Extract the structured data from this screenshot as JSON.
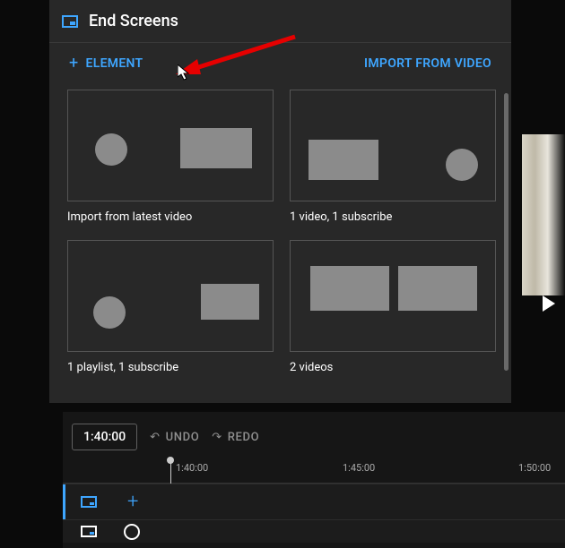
{
  "header": {
    "title": "End Screens"
  },
  "actions": {
    "element_label": "ELEMENT",
    "import_label": "IMPORT FROM VIDEO"
  },
  "templates": [
    {
      "label": "Import from latest video"
    },
    {
      "label": "1 video, 1 subscribe"
    },
    {
      "label": "1 playlist, 1 subscribe"
    },
    {
      "label": "2 videos"
    }
  ],
  "timeline": {
    "current_time": "1:40:00",
    "undo_label": "UNDO",
    "redo_label": "REDO",
    "ticks": [
      "1:40:00",
      "1:45:00",
      "1:50:00"
    ]
  },
  "colors": {
    "accent": "#3ea6ff"
  }
}
